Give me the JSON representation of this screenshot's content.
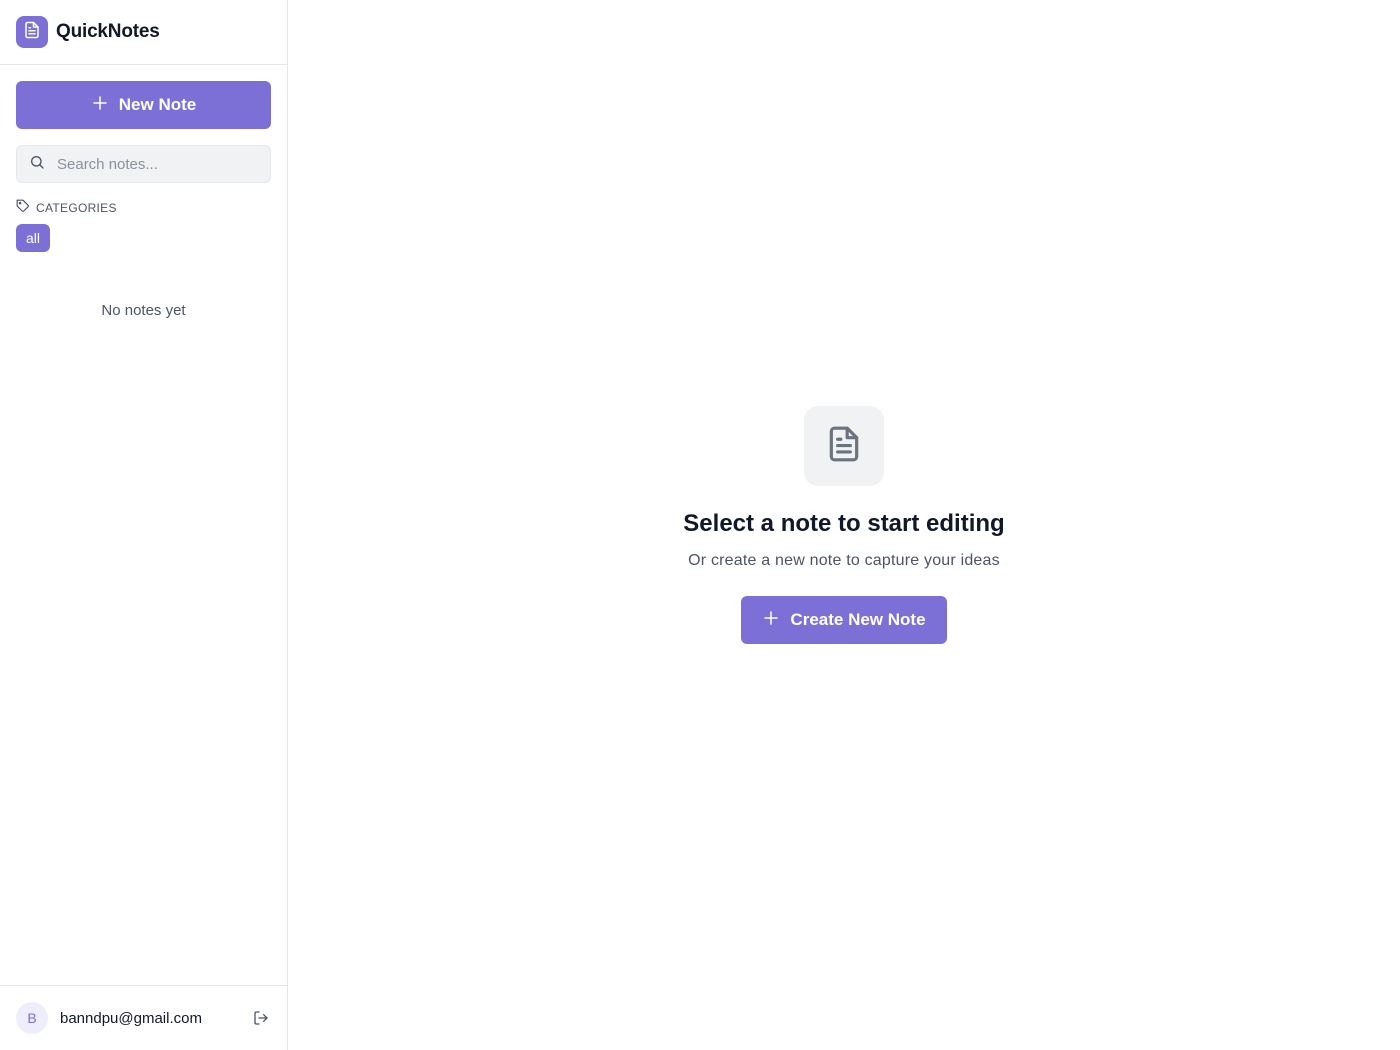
{
  "app": {
    "name": "QuickNotes"
  },
  "sidebar": {
    "new_note_label": "New Note",
    "search_placeholder": "Search notes...",
    "search_value": "",
    "categories_label": "CATEGORIES",
    "categories": [
      {
        "label": "all",
        "active": true
      }
    ],
    "empty_text": "No notes yet"
  },
  "user": {
    "initial": "B",
    "email": "banndpu@gmail.com"
  },
  "main": {
    "title": "Select a note to start editing",
    "subtitle": "Or create a new note to capture your ideas",
    "create_label": "Create New Note"
  },
  "colors": {
    "accent": "#7c6fd6",
    "muted_bg": "#f0f2f4",
    "border": "#e5e7eb",
    "text": "#111827",
    "text_muted": "#4b5563"
  },
  "icons": [
    "document-icon",
    "plus-icon",
    "search-icon",
    "tag-icon",
    "logout-icon"
  ]
}
